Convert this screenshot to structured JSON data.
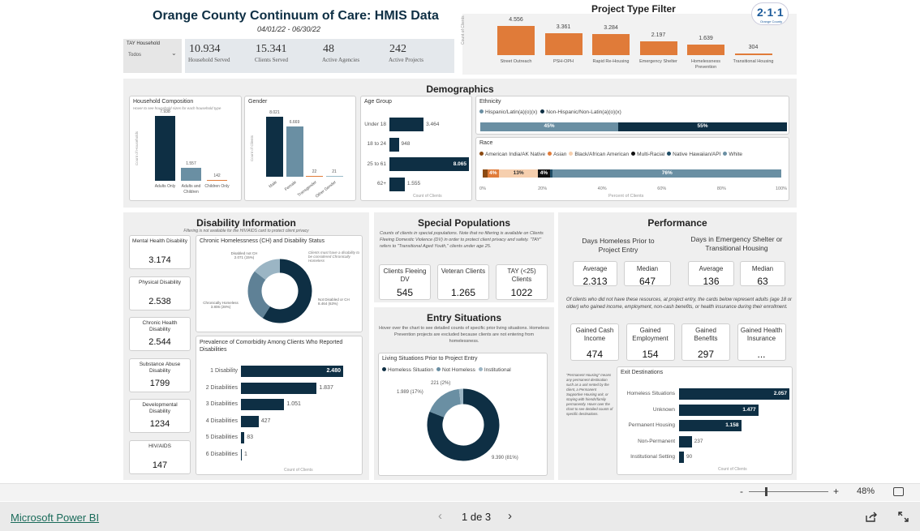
{
  "header": {
    "title": "Orange County Continuum of Care: HMIS Data",
    "date_range": "04/01/22 - 06/30/22"
  },
  "filter": {
    "label": "TAY Household",
    "value": "Todos"
  },
  "kpis": [
    {
      "value": "10.934",
      "label": "Household Served"
    },
    {
      "value": "15.341",
      "label": "Clients Served"
    },
    {
      "value": "48",
      "label": "Active Agencies"
    },
    {
      "value": "242",
      "label": "Active Projects"
    }
  ],
  "project_filter": {
    "title": "Project Type Filter",
    "ylabel": "Count of Clients",
    "bars": [
      {
        "label": "Street Outreach",
        "value": 4556,
        "text": "4.556"
      },
      {
        "label": "PSH-OPH",
        "value": 3361,
        "text": "3.361"
      },
      {
        "label": "Rapid Re-Housing",
        "value": 3284,
        "text": "3.284"
      },
      {
        "label": "Emergency Shelter",
        "value": 2197,
        "text": "2.197"
      },
      {
        "label": "Homelessness Prevention",
        "value": 1639,
        "text": "1.639"
      },
      {
        "label": "Transitional Housing",
        "value": 304,
        "text": "304"
      }
    ],
    "color": "#e07b39"
  },
  "logo": {
    "text": "2·1·1",
    "sub": "Orange County"
  },
  "demographics": {
    "title": "Demographics",
    "household": {
      "title": "Household Composition",
      "subtitle": "Hover to see household sizes for each household type",
      "ylabel": "Count of Households",
      "bars": [
        {
          "label": "Adults Only",
          "value": 7938,
          "text": "7.938",
          "color": "#0e2f44"
        },
        {
          "label": "Adults and Children",
          "value": 1557,
          "text": "1.557",
          "color": "#6a8fa3"
        },
        {
          "label": "Children Only",
          "value": 142,
          "text": "142",
          "color": "#e07b39"
        }
      ]
    },
    "gender": {
      "title": "Gender",
      "ylabel": "Count of Clients",
      "bars": [
        {
          "label": "Male",
          "value": 8021,
          "text": "8.021",
          "color": "#0e2f44"
        },
        {
          "label": "Female",
          "value": 6669,
          "text": "6.669",
          "color": "#6a8fa3"
        },
        {
          "label": "Transgender",
          "value": 22,
          "text": "22",
          "color": "#e07b39"
        },
        {
          "label": "Other Gender",
          "value": 21,
          "text": "21",
          "color": "#9bbcc9"
        }
      ]
    },
    "age": {
      "title": "Age Group",
      "xlabel": "Count of Clients",
      "bars": [
        {
          "label": "Under 18",
          "value": 3464,
          "text": "3.464"
        },
        {
          "label": "18 to 24",
          "value": 948,
          "text": "948"
        },
        {
          "label": "25 to 61",
          "value": 8065,
          "text": "8.065"
        },
        {
          "label": "62+",
          "value": 1555,
          "text": "1.555"
        }
      ]
    },
    "ethnicity": {
      "title": "Ethnicity",
      "legend": [
        {
          "name": "Hispanic/Latin(a)(o)(x)",
          "color": "#6a8fa3"
        },
        {
          "name": "Non-Hispanic/Non-Latin(a)(o)(x)",
          "color": "#0e2f44"
        }
      ],
      "segments": [
        {
          "pct": 45,
          "text": "45%",
          "color": "#6a8fa3"
        },
        {
          "pct": 55,
          "text": "55%",
          "color": "#0e2f44"
        }
      ]
    },
    "race": {
      "title": "Race",
      "xlabel": "Percent of Clients",
      "ticks": [
        "0%",
        "20%",
        "40%",
        "60%",
        "80%",
        "100%"
      ],
      "legend": [
        {
          "name": "American India/AK Native",
          "color": "#8b4a12"
        },
        {
          "name": "Asian",
          "color": "#e07b39"
        },
        {
          "name": "Black/African American",
          "color": "#f6cfae"
        },
        {
          "name": "Multi-Racial",
          "color": "#111111"
        },
        {
          "name": "Native Hawaiian/API",
          "color": "#1f4d66"
        },
        {
          "name": "White",
          "color": "#6a8fa3"
        }
      ],
      "segments": [
        {
          "pct": 1.5,
          "text": "",
          "color": "#8b4a12"
        },
        {
          "pct": 4,
          "text": "4%",
          "color": "#e07b39"
        },
        {
          "pct": 13,
          "text": "13%",
          "color": "#f6cfae"
        },
        {
          "pct": 4,
          "text": "4%",
          "color": "#111111"
        },
        {
          "pct": 1,
          "text": "",
          "color": "#1f4d66"
        },
        {
          "pct": 76.5,
          "text": "76%",
          "color": "#6a8fa3"
        }
      ]
    }
  },
  "disability": {
    "title": "Disability Information",
    "note": "Filtering is not available for the HIV/AIDS card to protect client privacy",
    "cards": [
      {
        "label": "Mental Health Disability",
        "value": "3.174"
      },
      {
        "label": "Physical Disability",
        "value": "2.538"
      },
      {
        "label": "Chronic Health Disability",
        "value": "2.544"
      },
      {
        "label": "Substance Abuse Disability",
        "value": "1799"
      },
      {
        "label": "Developmental Disability",
        "value": "1234"
      },
      {
        "label": "HIV/AIDS",
        "value": "147"
      }
    ],
    "donut": {
      "title": "Chronic Homelessness (CH) and Disability Status",
      "slices": [
        {
          "value": 8464,
          "pct": 63,
          "color": "#0e2f44",
          "label": "Not Disabled or CH 8.464 (63%)"
        },
        {
          "value": 3806,
          "pct": 28,
          "color": "#5f8196",
          "label": "Chronically Homeless 3.806 (28%)"
        },
        {
          "value": 2071,
          "pct": 15,
          "color": "#9bb5c4",
          "label": "Disabled not CH 2.071 (15%)"
        }
      ],
      "note": "Clients must have a disability to be considered Chronically Homeless"
    },
    "comorbidity": {
      "title": "Prevalence of Comorbidity Among Clients Who Reported Disabilities",
      "xlabel": "Count of Clients",
      "bars": [
        {
          "label": "1 Disability",
          "value": 2480,
          "text": "2.480"
        },
        {
          "label": "2 Disabilities",
          "value": 1837,
          "text": "1.837"
        },
        {
          "label": "3 Disabilities",
          "value": 1051,
          "text": "1.051"
        },
        {
          "label": "4 Disabilities",
          "value": 427,
          "text": "427"
        },
        {
          "label": "5 Disabilities",
          "value": 83,
          "text": "83"
        },
        {
          "label": "6 Disabilities",
          "value": 1,
          "text": "1"
        }
      ]
    }
  },
  "special": {
    "title": "Special Populations",
    "note": "Counts of clients in special populations. Note that no filtering is available on Clients Fleeing Domestic Violence (DV) in order to protect client privacy and safety. \"TAY\" refers to \"Transitional Aged Youth,\" clients under age 25.",
    "cards": [
      {
        "label": "Clients Fleeing DV",
        "value": "545"
      },
      {
        "label": "Veteran Clients",
        "value": "1.265"
      },
      {
        "label": "TAY (<25) Clients",
        "value": "1022"
      }
    ]
  },
  "entry": {
    "title": "Entry Situations",
    "note": "Hover over the chart to see detailed counts of specific prior living situations. Homeless Prevention projects are excluded because clients are not entering from homelessness.",
    "chart_title": "Living Situations Prior to Project Entry",
    "legend": [
      {
        "name": "Homeless Situation",
        "color": "#0e2f44"
      },
      {
        "name": "Not Homeless",
        "color": "#6a8fa3"
      },
      {
        "name": "Institutional",
        "color": "#9bb5c4"
      }
    ],
    "slices": [
      {
        "value": 9390,
        "pct": 81,
        "color": "#0e2f44",
        "label": "9.390 (81%)"
      },
      {
        "value": 1989,
        "pct": 17,
        "color": "#6a8fa3",
        "label": "1.989 (17%)"
      },
      {
        "value": 221,
        "pct": 2,
        "color": "#9bb5c4",
        "label": "221 (2%)"
      }
    ]
  },
  "performance": {
    "title": "Performance",
    "g1": {
      "title": "Days Homeless Prior to Project Entry",
      "avg_label": "Average",
      "avg": "2.313",
      "med_label": "Median",
      "med": "647"
    },
    "g2": {
      "title": "Days in Emergency Shelter or Transitional Housing",
      "avg_label": "Average",
      "avg": "136",
      "med_label": "Median",
      "med": "63"
    },
    "note": "Of clients who did not have these resources, at project entry, the cards below represent adults (age 18 or older) who gained income, employment, non-cash benefits, or health insurance during their enrollment.",
    "gained": [
      {
        "label": "Gained Cash Income",
        "value": "474"
      },
      {
        "label": "Gained Employment",
        "value": "154"
      },
      {
        "label": "Gained Benefits",
        "value": "297"
      },
      {
        "label": "Gained Health Insurance",
        "value": "..."
      }
    ],
    "ph_note": "\"Permanent Housing\" means any permanent destination such as a unit rented by the client, a Permanent Supportive Housing unit, or staying with friends/family permanently. Hover over the chart to see detailed counts of specific destinations.",
    "exit": {
      "title": "Exit Destinations",
      "xlabel": "Count of Clients",
      "bars": [
        {
          "label": "Homeless Situations",
          "value": 2057,
          "text": "2.057"
        },
        {
          "label": "Unknown",
          "value": 1477,
          "text": "1.477"
        },
        {
          "label": "Permanent Housing",
          "value": 1158,
          "text": "1.158"
        },
        {
          "label": "Non-Permanent",
          "value": 237,
          "text": "237"
        },
        {
          "label": "Institutional Setting",
          "value": 90,
          "text": "90"
        }
      ]
    }
  },
  "zoom": {
    "minus": "-",
    "plus": "+",
    "value": "48%",
    "level": 48
  },
  "footer": {
    "brand": "Microsoft Power BI",
    "page": "1 de 3"
  }
}
